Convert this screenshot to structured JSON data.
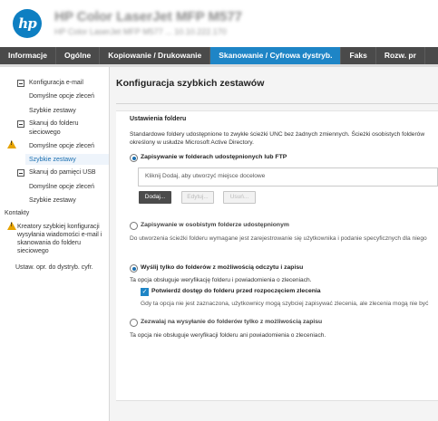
{
  "header": {
    "logo_text": "hp",
    "printer_name": "HP Color LaserJet MFP M577",
    "printer_sub": "HP Color LaserJet MFP M577 ... 10.10.222.170"
  },
  "nav": {
    "tabs": [
      {
        "label": "Informacje"
      },
      {
        "label": "Ogólne"
      },
      {
        "label": "Kopiowanie / Drukowanie"
      },
      {
        "label": "Skanowanie / Cyfrowa dystryb."
      },
      {
        "label": "Faks"
      },
      {
        "label": "Rozw. pr"
      }
    ],
    "active_index": 3
  },
  "sidebar": {
    "email_config": "Konfiguracja e-mail",
    "email_defaults": "Domyślne opcje zleceń",
    "email_quicksets": "Szybkie zestawy",
    "folder_line1": "Skanuj do folderu",
    "folder_line2": "sieciowego",
    "folder_defaults": "Domyślne opcje zleceń",
    "folder_quicksets": "Szybkie zestawy",
    "usb": "Skanuj do pamięci USB",
    "usb_defaults": "Domyślne opcje zleceń",
    "usb_quicksets": "Szybkie zestawy",
    "contacts": "Kontakty",
    "wizard_line1": "Kreatory szybkiej konfiguracji",
    "wizard_line2": "wysyłania wiadomości e-mail i",
    "wizard_line3": "skanowania do folderu",
    "wizard_line4": "sieciowego",
    "settings": "Ustaw. opr. do dystryb. cyfr."
  },
  "main": {
    "title": "Konfiguracja szybkich zestawów",
    "section_title": "Ustawienia folderu",
    "desc_line1": "Standardowe foldery udostępnione to zwykłe ścieżki UNC bez żadnych zmiennych. Ścieżki osobistych folderów",
    "desc_line2": "określony w usłudze Microsoft Active Directory.",
    "opt_shared": "Zapisywanie w folderach udostępnionych lub FTP",
    "listbox_placeholder": "Kliknij Dodaj, aby utworzyć miejsce docelowe",
    "btn_add": "Dodaj...",
    "btn_edit": "Edytuj...",
    "btn_remove": "Usuń...",
    "opt_personal": "Zapisywanie w osobistym folderze udostępnionym",
    "personal_desc": "Do utworzenia ścieżki folderu wymagane jest zarejestrowanie się użytkownika i podanie specyficznych dla niego",
    "opt_rw": "Wyślij tylko do folderów z możliwością odczytu i zapisu",
    "rw_desc": "Ta opcja obsługuje weryfikację folderu i powiadomienia o zleceniach.",
    "chk_verify": "Potwierdź dostęp do folderu przed rozpoczęciem zlecenia",
    "verify_desc": "Gdy ta opcja nie jest zaznaczona, użytkownicy mogą szybciej zapisywać zlecenia, ale zlecenia mogą nie być",
    "opt_writeonly": "Zezwalaj na wysyłanie do folderów tylko z możliwością zapisu",
    "writeonly_desc": "Ta opcja nie obsługuje weryfikacji folderu ani powiadomienia o zleceniach."
  },
  "colors": {
    "nav_bg": "#4a4a4a",
    "nav_active": "#1e85c6",
    "logo": "#0e7fc2",
    "link": "#1a6fb0",
    "warning": "#e6a300"
  }
}
